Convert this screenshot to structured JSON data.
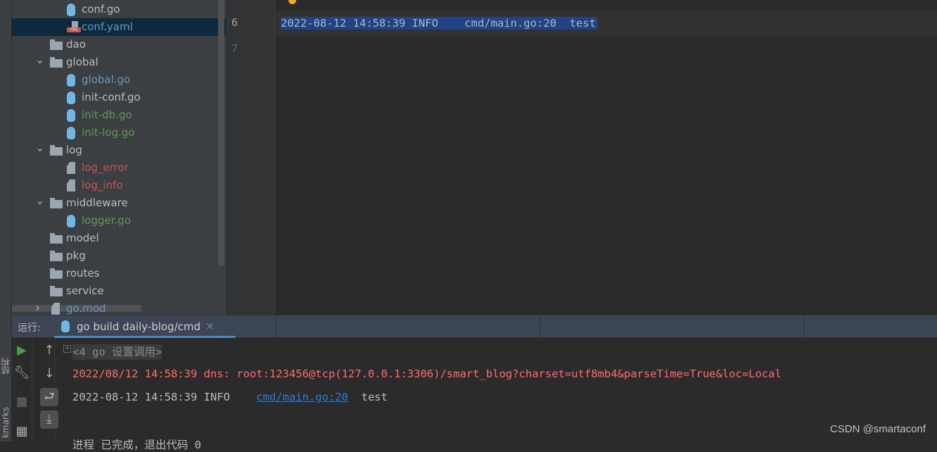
{
  "left_strip": {
    "labels": [
      "结构",
      "kmarks"
    ]
  },
  "tree": {
    "items": [
      {
        "label": "conf.go",
        "icon": "gopher-icon",
        "color": "default",
        "depth": 2
      },
      {
        "label": "conf.yaml",
        "icon": "yaml-icon",
        "color": "blue",
        "depth": 2,
        "selected": true
      },
      {
        "label": "dao",
        "icon": "folder-icon",
        "color": "default",
        "depth": 1
      },
      {
        "label": "global",
        "icon": "folder-icon",
        "color": "default",
        "depth": 1,
        "expanded": true
      },
      {
        "label": "global.go",
        "icon": "gopher-icon",
        "color": "blue",
        "depth": 2
      },
      {
        "label": "init-conf.go",
        "icon": "gopher-icon",
        "color": "default",
        "depth": 2
      },
      {
        "label": "init-db.go",
        "icon": "gopher-icon",
        "color": "green",
        "depth": 2
      },
      {
        "label": "init-log.go",
        "icon": "gopher-icon",
        "color": "green",
        "depth": 2
      },
      {
        "label": "log",
        "icon": "folder-icon",
        "color": "default",
        "depth": 1,
        "expanded": true
      },
      {
        "label": "log_error",
        "icon": "file-icon",
        "color": "red",
        "depth": 2
      },
      {
        "label": "log_info",
        "icon": "file-icon",
        "color": "red",
        "depth": 2
      },
      {
        "label": "middleware",
        "icon": "folder-icon",
        "color": "default",
        "depth": 1,
        "expanded": true
      },
      {
        "label": "logger.go",
        "icon": "gopher-icon",
        "color": "green",
        "depth": 2
      },
      {
        "label": "model",
        "icon": "folder-icon",
        "color": "default",
        "depth": 1
      },
      {
        "label": "pkg",
        "icon": "folder-icon",
        "color": "default",
        "depth": 1
      },
      {
        "label": "routes",
        "icon": "folder-icon",
        "color": "default",
        "depth": 1
      },
      {
        "label": "service",
        "icon": "folder-icon",
        "color": "default",
        "depth": 1
      },
      {
        "label": "go.mod",
        "icon": "file-icon",
        "color": "blue",
        "depth": 1,
        "collapsed": true
      }
    ]
  },
  "editor": {
    "line_numbers": [
      "6",
      "7"
    ],
    "lines": [
      "2022-08-12 14:58:39 INFO    cmd/main.go:20  test"
    ],
    "selection_color": "#214283"
  },
  "run": {
    "label": "运行:",
    "tab_title": "go build daily-blog/cmd",
    "close": "×",
    "console": {
      "fold": "<4 go 设置调用>",
      "error_line": "2022/08/12 14:58:39 dns: root:123456@tcp(127.0.0.1:3306)/smart_blog?charset=utf8mb4&parseTime=True&loc=Local",
      "info_prefix": "2022-08-12 14:58:39 INFO    ",
      "info_link": "cmd/main.go:20",
      "info_suffix": "  test",
      "exit_line": "进程 已完成，退出代码 0"
    },
    "colors": {
      "error": "#ff6b68",
      "link": "#287bde"
    }
  },
  "watermark": "CSDN @smartaconf"
}
